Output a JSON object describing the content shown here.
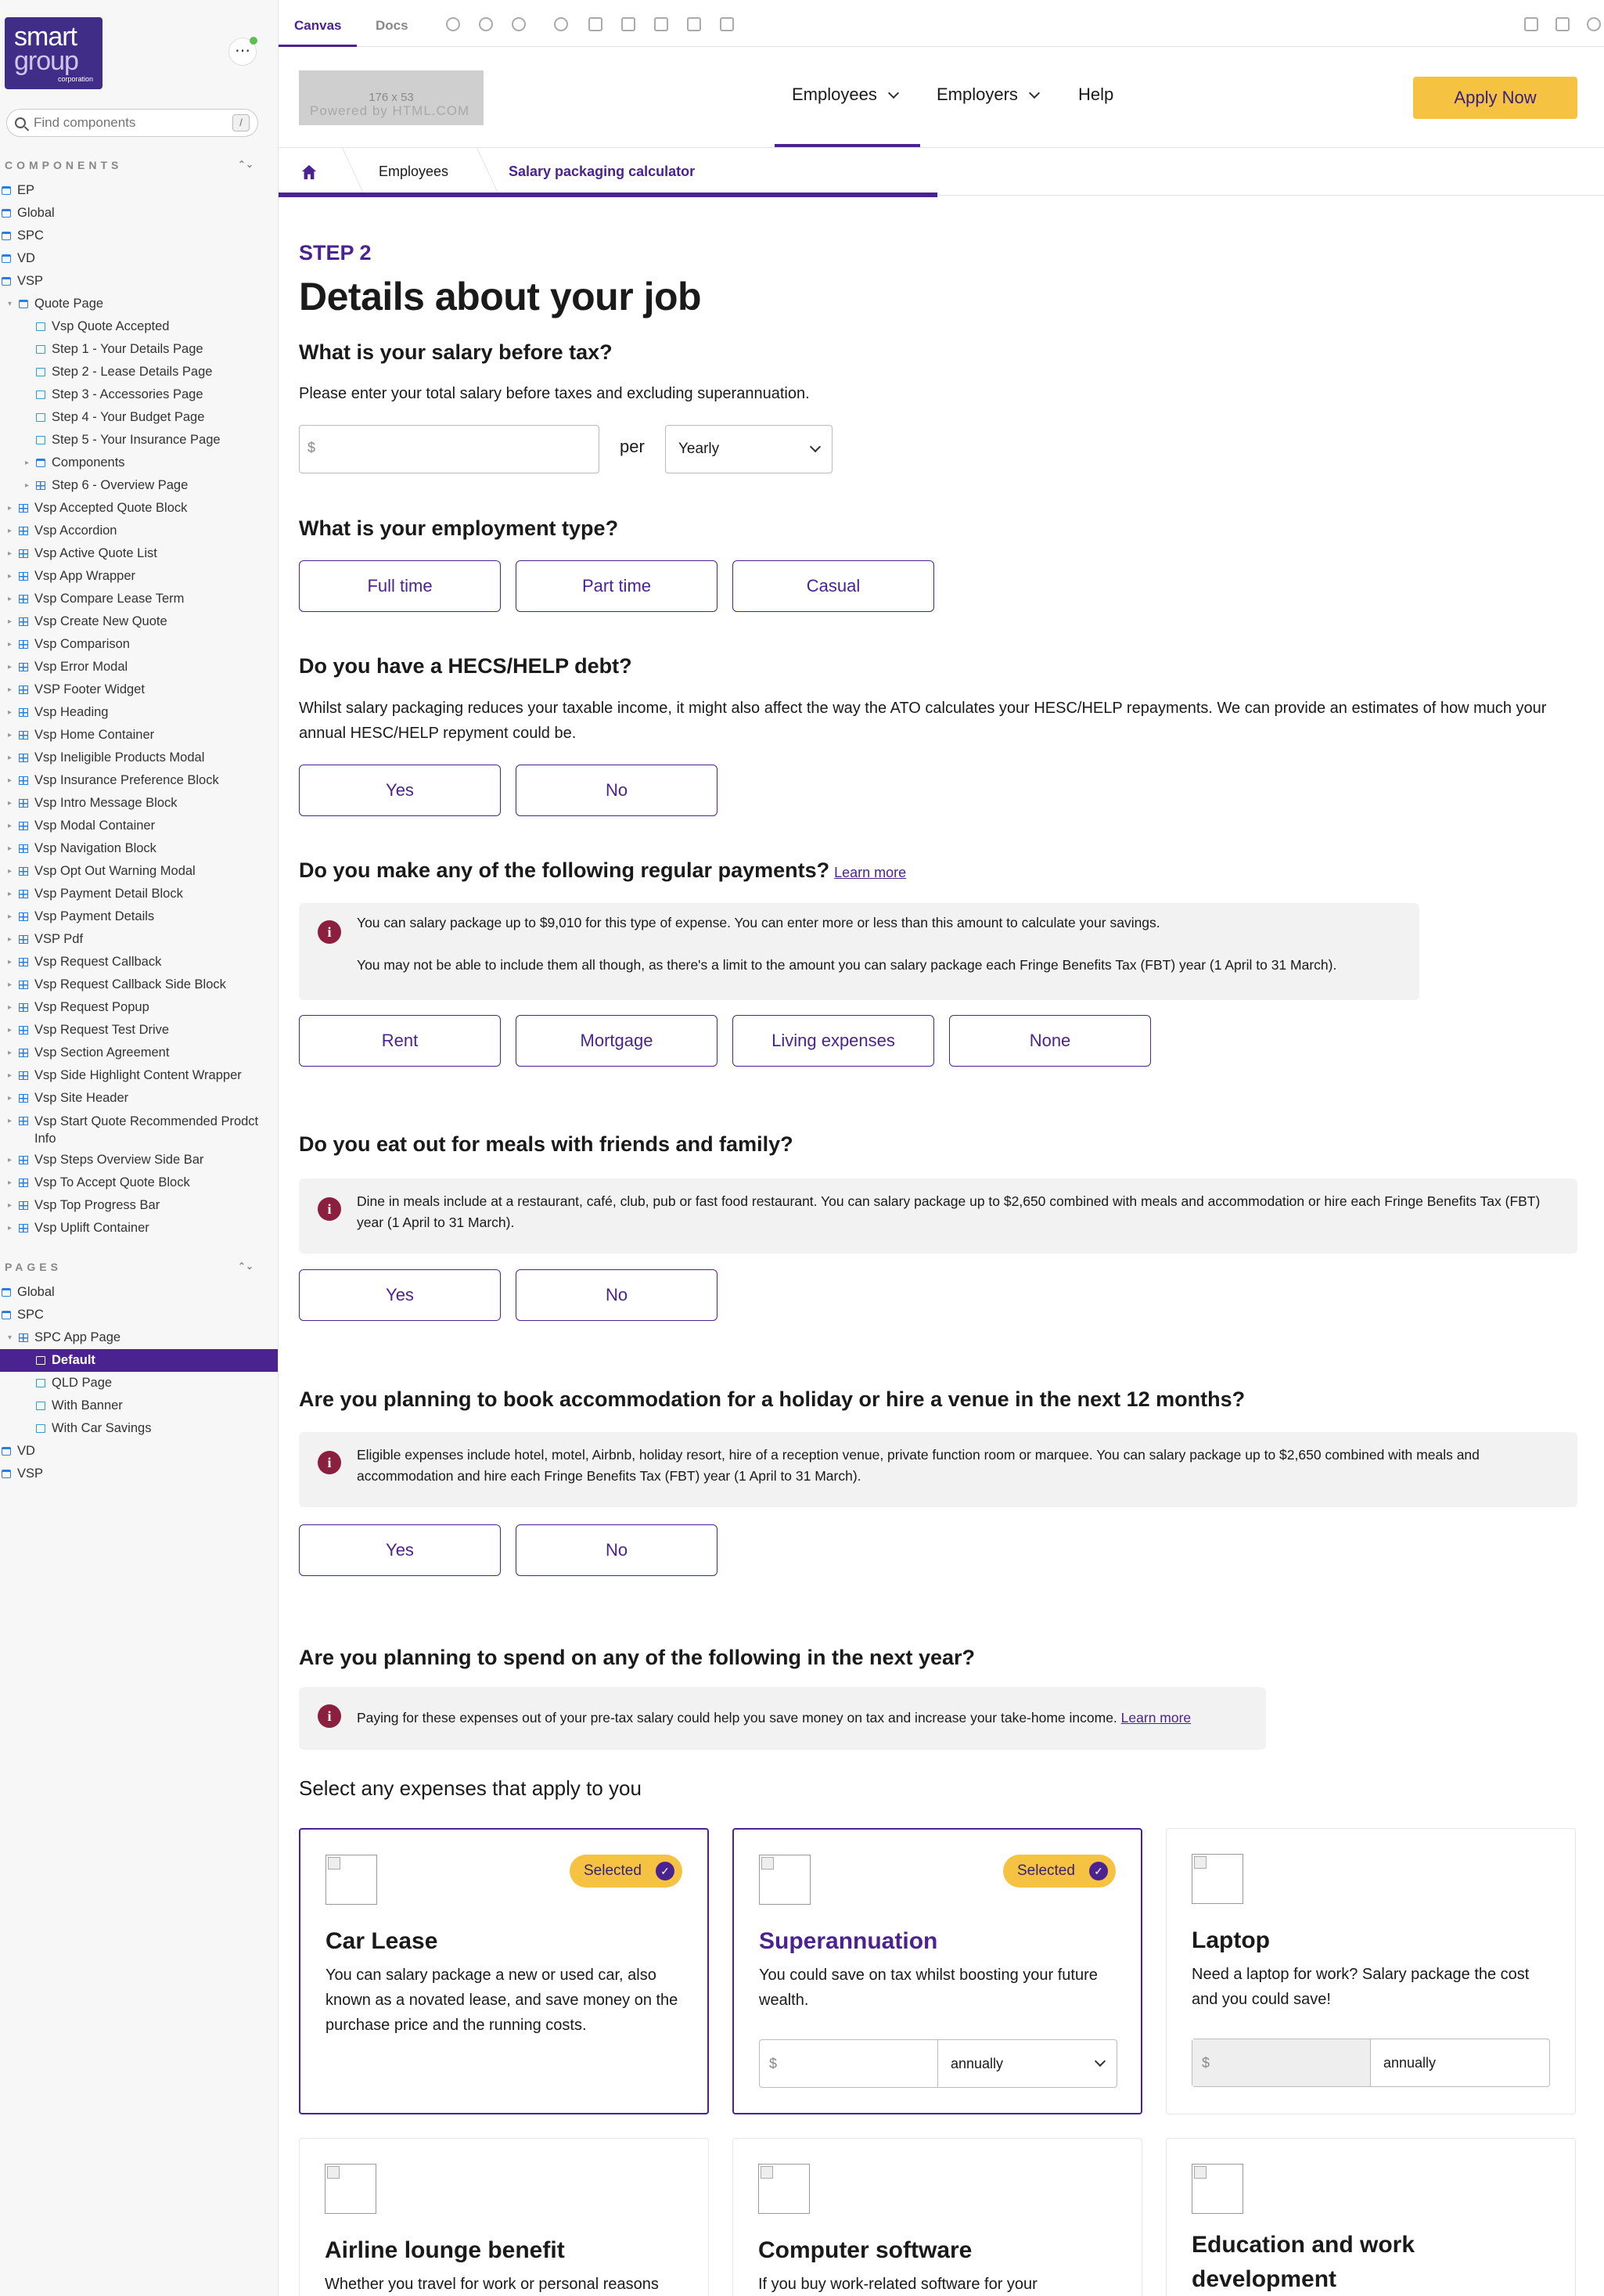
{
  "brand": {
    "line1": "smart",
    "line2": "group",
    "line3": "corporation"
  },
  "sidebar": {
    "search_placeholder": "Find components",
    "search_shortcut": "/",
    "components_title": "COMPONENTS",
    "pages_title": "PAGES",
    "components": [
      {
        "label": "EP",
        "level": 0,
        "icon": "folder"
      },
      {
        "label": "Global",
        "level": 0,
        "icon": "folder"
      },
      {
        "label": "SPC",
        "level": 0,
        "icon": "folder"
      },
      {
        "label": "VD",
        "level": 0,
        "icon": "folder"
      },
      {
        "label": "VSP",
        "level": 0,
        "icon": "folder"
      },
      {
        "label": "Quote Page",
        "level": 1,
        "icon": "folder",
        "caret": "open"
      },
      {
        "label": "Vsp Quote Accepted",
        "level": 2,
        "icon": "story"
      },
      {
        "label": "Step 1 - Your Details Page",
        "level": 2,
        "icon": "story"
      },
      {
        "label": "Step 2 - Lease Details Page",
        "level": 2,
        "icon": "story"
      },
      {
        "label": "Step 3 - Accessories Page",
        "level": 2,
        "icon": "story"
      },
      {
        "label": "Step 4 - Your Budget Page",
        "level": 2,
        "icon": "story"
      },
      {
        "label": "Step 5 - Your Insurance Page",
        "level": 2,
        "icon": "story"
      },
      {
        "label": "Components",
        "level": 2,
        "icon": "folder",
        "caret": "closed"
      },
      {
        "label": "Step 6 - Overview Page",
        "level": 2,
        "icon": "comp",
        "caret": "closed"
      },
      {
        "label": "Vsp Accepted Quote Block",
        "level": 1,
        "icon": "comp",
        "caret": "closed"
      },
      {
        "label": "Vsp Accordion",
        "level": 1,
        "icon": "comp",
        "caret": "closed"
      },
      {
        "label": "Vsp Active Quote List",
        "level": 1,
        "icon": "comp",
        "caret": "closed"
      },
      {
        "label": "Vsp App Wrapper",
        "level": 1,
        "icon": "comp",
        "caret": "closed"
      },
      {
        "label": "Vsp Compare Lease Term",
        "level": 1,
        "icon": "comp",
        "caret": "closed"
      },
      {
        "label": "Vsp Create New Quote",
        "level": 1,
        "icon": "comp",
        "caret": "closed"
      },
      {
        "label": "Vsp Comparison",
        "level": 1,
        "icon": "comp",
        "caret": "closed"
      },
      {
        "label": "Vsp Error Modal",
        "level": 1,
        "icon": "comp",
        "caret": "closed"
      },
      {
        "label": "VSP Footer Widget",
        "level": 1,
        "icon": "comp",
        "caret": "closed"
      },
      {
        "label": "Vsp Heading",
        "level": 1,
        "icon": "comp",
        "caret": "closed"
      },
      {
        "label": "Vsp Home Container",
        "level": 1,
        "icon": "comp",
        "caret": "closed"
      },
      {
        "label": "Vsp Ineligible Products Modal",
        "level": 1,
        "icon": "comp",
        "caret": "closed"
      },
      {
        "label": "Vsp Insurance Preference Block",
        "level": 1,
        "icon": "comp",
        "caret": "closed"
      },
      {
        "label": "Vsp Intro Message Block",
        "level": 1,
        "icon": "comp",
        "caret": "closed"
      },
      {
        "label": "Vsp Modal Container",
        "level": 1,
        "icon": "comp",
        "caret": "closed"
      },
      {
        "label": "Vsp Navigation Block",
        "level": 1,
        "icon": "comp",
        "caret": "closed"
      },
      {
        "label": "Vsp Opt Out Warning Modal",
        "level": 1,
        "icon": "comp",
        "caret": "closed"
      },
      {
        "label": "Vsp Payment Detail Block",
        "level": 1,
        "icon": "comp",
        "caret": "closed"
      },
      {
        "label": "Vsp Payment Details",
        "level": 1,
        "icon": "comp",
        "caret": "closed"
      },
      {
        "label": "VSP Pdf",
        "level": 1,
        "icon": "comp",
        "caret": "closed"
      },
      {
        "label": "Vsp Request Callback",
        "level": 1,
        "icon": "comp",
        "caret": "closed"
      },
      {
        "label": "Vsp Request Callback Side Block",
        "level": 1,
        "icon": "comp",
        "caret": "closed"
      },
      {
        "label": "Vsp Request Popup",
        "level": 1,
        "icon": "comp",
        "caret": "closed"
      },
      {
        "label": "Vsp Request Test Drive",
        "level": 1,
        "icon": "comp",
        "caret": "closed"
      },
      {
        "label": "Vsp Section Agreement",
        "level": 1,
        "icon": "comp",
        "caret": "closed"
      },
      {
        "label": "Vsp Side Highlight Content Wrapper",
        "level": 1,
        "icon": "comp",
        "caret": "closed"
      },
      {
        "label": "Vsp Site Header",
        "level": 1,
        "icon": "comp",
        "caret": "closed"
      },
      {
        "label": "Vsp Start Quote Recommended Prodct Info",
        "level": 1,
        "icon": "comp",
        "caret": "closed",
        "two_line": true
      },
      {
        "label": "Vsp Steps Overview Side Bar",
        "level": 1,
        "icon": "comp",
        "caret": "closed"
      },
      {
        "label": "Vsp To Accept Quote Block",
        "level": 1,
        "icon": "comp",
        "caret": "closed"
      },
      {
        "label": "Vsp Top Progress Bar",
        "level": 1,
        "icon": "comp",
        "caret": "closed"
      },
      {
        "label": "Vsp Uplift Container",
        "level": 1,
        "icon": "comp",
        "caret": "closed"
      }
    ],
    "pages": [
      {
        "label": "Global",
        "level": 0,
        "icon": "folder"
      },
      {
        "label": "SPC",
        "level": 0,
        "icon": "folder"
      },
      {
        "label": "SPC App Page",
        "level": 1,
        "icon": "comp",
        "caret": "open"
      },
      {
        "label": "Default",
        "level": 2,
        "icon": "story",
        "selected": true
      },
      {
        "label": "QLD Page",
        "level": 2,
        "icon": "story"
      },
      {
        "label": "With Banner",
        "level": 2,
        "icon": "story"
      },
      {
        "label": "With Car Savings",
        "level": 2,
        "icon": "story"
      },
      {
        "label": "VD",
        "level": 0,
        "icon": "folder"
      },
      {
        "label": "VSP",
        "level": 0,
        "icon": "folder"
      }
    ]
  },
  "toolbar": {
    "tab_canvas": "Canvas",
    "tab_docs": "Docs"
  },
  "site": {
    "logo_placeholder": "176 x 53",
    "logo_watermark": "Powered by HTML.COM",
    "nav_employees": "Employees",
    "nav_employers": "Employers",
    "nav_help": "Help",
    "apply": "Apply Now",
    "crumb_employees": "Employees",
    "crumb_current": "Salary packaging calculator"
  },
  "form": {
    "step": "STEP 2",
    "title": "Details about your job",
    "q_salary": "What is your salary before tax?",
    "q_salary_text": "Please enter your total salary before taxes and excluding superannuation.",
    "salary_placeholder": "$",
    "per": "per",
    "period": "Yearly",
    "q_employment": "What is your employment type?",
    "employment_options": [
      "Full time",
      "Part time",
      "Casual"
    ],
    "q_hecs": "Do you have a HECS/HELP debt?",
    "q_hecs_text": "Whilst salary packaging reduces your taxable income, it might also affect the way the ATO calculates your HESC/HELP repayments. We can provide an estimates of how much your annual HESC/HELP repyment could be.",
    "yes": "Yes",
    "no": "No",
    "q_payments": "Do you make any of the following regular payments?",
    "learn_more": "Learn more",
    "payments_info_1": "You can salary package up to $9,010 for this type of expense. You can enter more or less than this amount to calculate your savings.",
    "payments_info_2": "You may not be able to include them all though, as there's a limit to the amount you can salary package each Fringe Benefits Tax (FBT) year (1 April to 31 March).",
    "payment_options": [
      "Rent",
      "Mortgage",
      "Living expenses",
      "None"
    ],
    "q_meals": "Do you eat out for meals with friends and family?",
    "meals_info": "Dine in meals include at a restaurant, café, club, pub or fast food restaurant. You can salary package up to $2,650 combined with meals and accommodation or hire each Fringe Benefits Tax (FBT) year (1 April to 31 March).",
    "q_accommodation": "Are you planning to book accommodation for a holiday or hire a venue in the next 12 months?",
    "accommodation_info": "Eligible expenses include hotel, motel, Airbnb, holiday resort, hire of a reception venue, private function room or marquee. You can salary package up to $2,650 combined with meals and accommodation and hire each Fringe Benefits Tax (FBT) year (1 April to 31 March).",
    "q_spend": "Are you planning to spend on any of the following in the next year?",
    "spend_info": "Paying for these expenses out of your pre-tax salary could help you save money on tax and increase your take-home income.",
    "select_expenses": "Select any expenses that apply to you",
    "selected_label": "Selected",
    "amount_placeholder": "$",
    "annually": "annually"
  },
  "cards": [
    {
      "title": "Car Lease",
      "desc": "You can salary package a new or used car, also known as a novated lease, and save money on the purchase price and the running costs.",
      "selected": true
    },
    {
      "title": "Superannuation",
      "desc": "You could save on tax whilst boosting your future wealth.",
      "selected": true
    },
    {
      "title": "Laptop",
      "desc": "Need a laptop for work? Salary package the cost and you could save!",
      "selected": false
    },
    {
      "title": "Airline lounge benefit",
      "desc": "Whether you travel for work or personal reasons",
      "selected": false
    },
    {
      "title": "Computer software",
      "desc": "If you buy work-related software for your",
      "selected": false
    },
    {
      "title": "Education and work development",
      "desc": "",
      "selected": false
    }
  ],
  "colors": {
    "brand_purple": "#4b2390",
    "accent_yellow": "#f5c242",
    "info_icon": "#8b1f3f"
  }
}
